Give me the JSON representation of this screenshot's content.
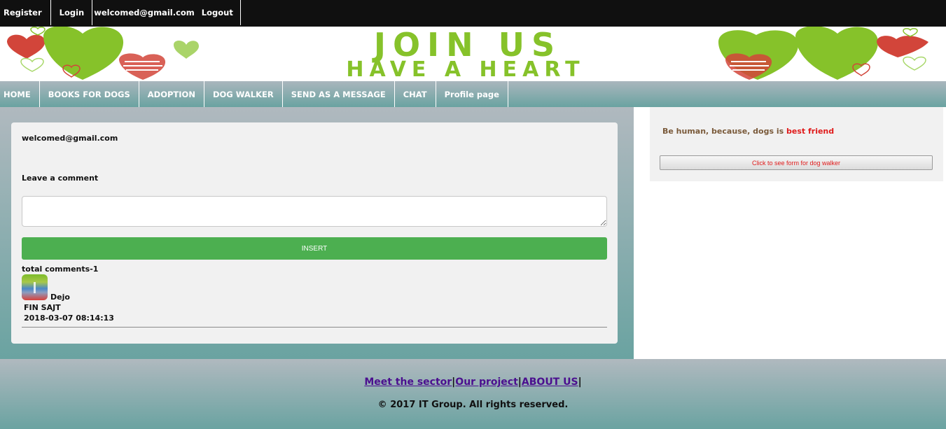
{
  "topbar": {
    "register": "Register",
    "login": "Login",
    "email": "welcomed@gmail.com",
    "logout": "Logout"
  },
  "banner": {
    "line1": "JOIN US",
    "line2": "HAVE A HEART",
    "colors": {
      "green": "#86c22a",
      "red": "#d2453a"
    }
  },
  "nav": {
    "items": [
      {
        "label": "HOME"
      },
      {
        "label": "BOOKS FOR DOGS"
      },
      {
        "label": "ADOPTION"
      },
      {
        "label": "DOG WALKER"
      },
      {
        "label": "SEND AS A MESSAGE"
      },
      {
        "label": "CHAT"
      },
      {
        "label": "Profile page"
      }
    ]
  },
  "main": {
    "user_email": "welcomed@gmail.com",
    "leave_comment": "Leave a comment",
    "comment_value": "",
    "insert_label": "INSERT",
    "total_comments": "total comments-1",
    "comments": [
      {
        "author": "Dejo",
        "text": "FIN SAJT",
        "date": "2018-03-07 08:14:13"
      }
    ]
  },
  "sidebar": {
    "quote_prefix": "Be human, because, dogs is ",
    "quote_highlight": "best friend",
    "walker_button": "Click to see form for dog walker"
  },
  "footer": {
    "link1": "Meet the sector",
    "link2": "Our project",
    "link3": "ABOUT US",
    "separator": "|",
    "copyright": "© 2017 IT Group. All rights reserved."
  },
  "colors": {
    "insert_button": "#4caf50",
    "highlight": "#e01b1b",
    "link": "#4b0f8f"
  }
}
